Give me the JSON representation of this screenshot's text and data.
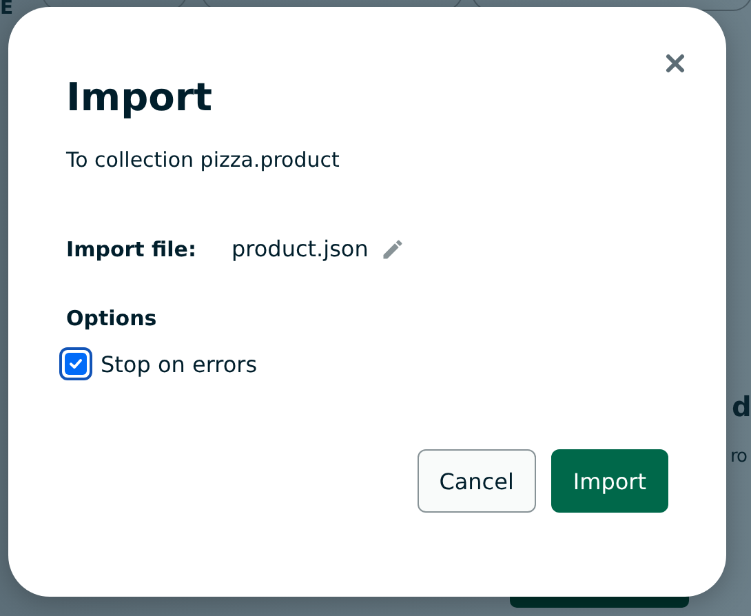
{
  "background": {
    "corner_text": "E",
    "heading_fragment": "d",
    "text_fragment": "ro"
  },
  "dialog": {
    "title": "Import",
    "subtitle": "To collection pizza.product",
    "file_label": "Import file:",
    "file_name": "product.json",
    "options_heading": "Options",
    "options": [
      {
        "label": "Stop on errors",
        "checked": true
      }
    ],
    "buttons": [
      {
        "label": "Cancel",
        "kind": "secondary"
      },
      {
        "label": "Import",
        "kind": "primary"
      }
    ]
  }
}
